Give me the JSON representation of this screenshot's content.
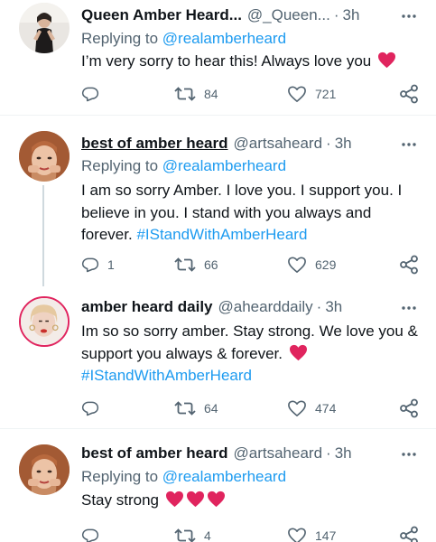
{
  "tweets": [
    {
      "name": "Queen Amber Heard...",
      "handle": "@_Queen...",
      "separator": "·",
      "time": "3h",
      "replying_prefix": "Replying to ",
      "replying_to": "@realamberheard",
      "text": "I’m very sorry to hear this! Always love you",
      "hashtag": "",
      "hearts": 1,
      "replies": "",
      "retweets": "84",
      "likes": "721"
    },
    {
      "name": "best of amber heard",
      "handle": "@artsaheard",
      "separator": "·",
      "time": "3h",
      "replying_prefix": "Replying to ",
      "replying_to": "@realamberheard",
      "text": "I am so sorry Amber. I love you. I support you. I believe in you. I stand with you always and forever.",
      "hashtag": "#IStandWithAmberHeard",
      "hearts": 0,
      "replies": "1",
      "retweets": "66",
      "likes": "629"
    },
    {
      "name": "amber heard daily",
      "handle": "@ahearddaily",
      "separator": "·",
      "time": "3h",
      "text": "Im so so sorry amber. Stay strong. We love you & support you always & forever.",
      "hashtag": "#IStandWithAmberHeard",
      "hearts": 1,
      "replies": "",
      "retweets": "64",
      "likes": "474"
    },
    {
      "name": "best of amber heard",
      "handle": "@artsaheard",
      "separator": "·",
      "time": "3h",
      "replying_prefix": "Replying to ",
      "replying_to": "@realamberheard",
      "text": "Stay strong",
      "hashtag": "",
      "hearts": 3,
      "replies": "",
      "retweets": "4",
      "likes": "147"
    }
  ],
  "icons": {
    "reply": "reply-icon",
    "retweet": "retweet-icon",
    "like": "like-icon",
    "share": "share-icon",
    "more": "more-icon",
    "heart_emoji": "red-heart-emoji"
  },
  "colors": {
    "text": "#0f1419",
    "secondary": "#536471",
    "link": "#1d9bf0",
    "divider": "#eff3f4",
    "heart": "#e0245e"
  }
}
